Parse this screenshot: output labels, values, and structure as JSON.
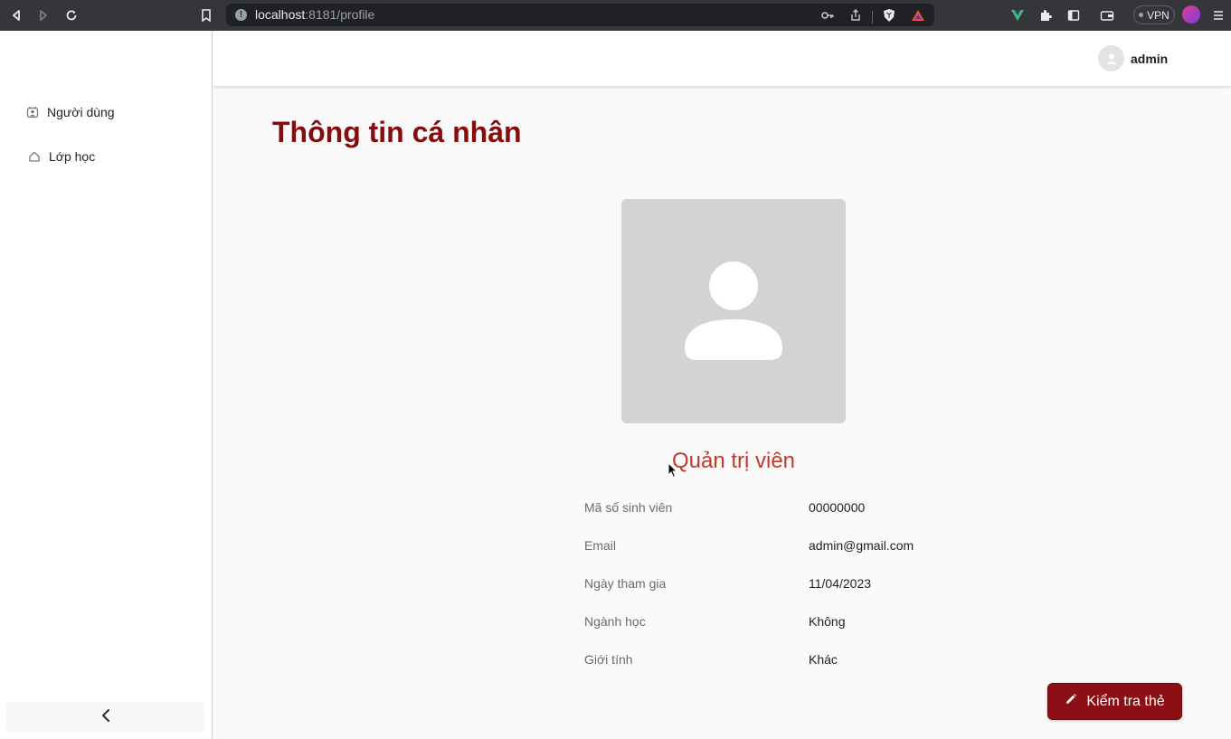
{
  "browser": {
    "url_host": "localhost",
    "url_path": ":8181/profile",
    "vpn_label": "VPN"
  },
  "header": {
    "username": "admin"
  },
  "sidebar": {
    "items": [
      {
        "label": "Người dùng",
        "icon": "users-icon"
      },
      {
        "label": "Lớp học",
        "icon": "home-icon"
      }
    ],
    "collapse_icon": "chevron-left-icon"
  },
  "page": {
    "title": "Thông tin cá nhân",
    "role": "Quản trị viên",
    "fields": [
      {
        "label": "Mã số sinh viên",
        "value": "00000000"
      },
      {
        "label": "Email",
        "value": "admin@gmail.com"
      },
      {
        "label": "Ngày tham gia",
        "value": "11/04/2023"
      },
      {
        "label": "Ngành học",
        "value": "Không"
      },
      {
        "label": "Giới tính",
        "value": "Khác"
      }
    ],
    "edit_button_label": "Kiểm tra thẻ"
  },
  "colors": {
    "title": "#850d0d",
    "role": "#c0392b",
    "button": "#8b0f14"
  }
}
